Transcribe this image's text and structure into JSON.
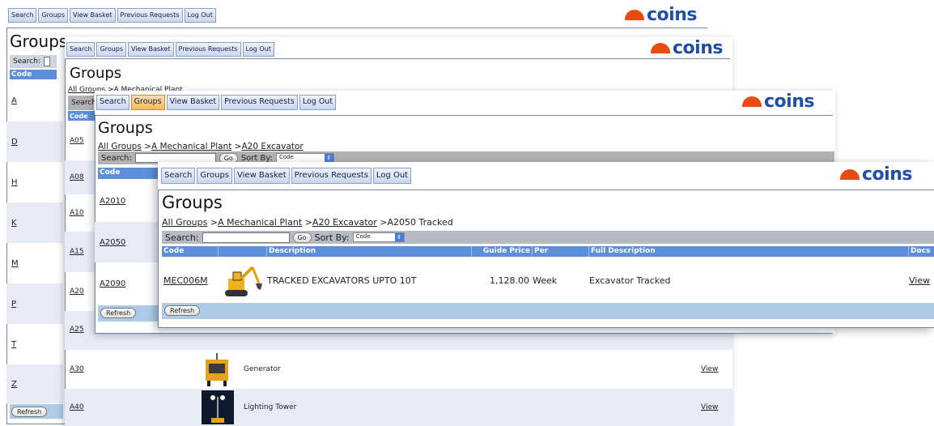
{
  "nav": [
    "Search",
    "Groups",
    "View Basket",
    "Previous Requests",
    "Log Out"
  ],
  "logo_text": "coins",
  "colors": {
    "accent": "#5c8edb",
    "logo_orange": "#e84c13",
    "logo_blue": "#1f4fa8",
    "nav_active": "#f5b862"
  },
  "title": "Groups",
  "search_label": "Search:",
  "go_label": "Go",
  "sort_label": "Sort By:",
  "sort_value": "Code",
  "refresh_label": "Refresh",
  "win1": {
    "code_header": "Code",
    "rows": [
      "A",
      "D",
      "H",
      "K",
      "M",
      "P",
      "T",
      "Z"
    ]
  },
  "win2": {
    "crumb": "All Groups >A Mechanical Plant",
    "crumb_parts": [
      "All Groups",
      " >",
      "A Mechanical Plant"
    ],
    "code_header": "Code",
    "rows": [
      {
        "code": "A05",
        "desc": "",
        "view": ""
      },
      {
        "code": "A08",
        "desc": "",
        "view": ""
      },
      {
        "code": "A10",
        "desc": "",
        "view": ""
      },
      {
        "code": "A15",
        "desc": "",
        "view": ""
      },
      {
        "code": "A20",
        "desc": "",
        "view": ""
      },
      {
        "code": "A25",
        "desc": "",
        "view": ""
      },
      {
        "code": "A30",
        "desc": "Generator",
        "view": "View"
      },
      {
        "code": "A40",
        "desc": "Lighting Tower",
        "view": "View"
      }
    ]
  },
  "win3": {
    "crumb_parts": [
      "All Groups",
      " >",
      "A Mechanical Plant",
      " >",
      "A20 Excavator"
    ],
    "code_header": "Code",
    "rows": [
      "A2010",
      "A2050",
      "A2090"
    ]
  },
  "win4": {
    "crumb_parts": [
      "All Groups",
      " >",
      "A Mechanical Plant",
      " >",
      "A20 Excavator",
      " >",
      "A2050 Tracked"
    ],
    "headers": {
      "code": "Code",
      "description": "Description",
      "guide_price": "Guide Price",
      "per": "Per",
      "full_description": "Full Description",
      "docs": "Docs"
    },
    "row": {
      "code": "MEC006M",
      "icon": "excavator-image",
      "description": "TRACKED EXCAVATORS UPTO 10T",
      "price": "1,128.00",
      "per": "Week",
      "full_description": "Excavator Tracked",
      "docs": "View"
    }
  }
}
